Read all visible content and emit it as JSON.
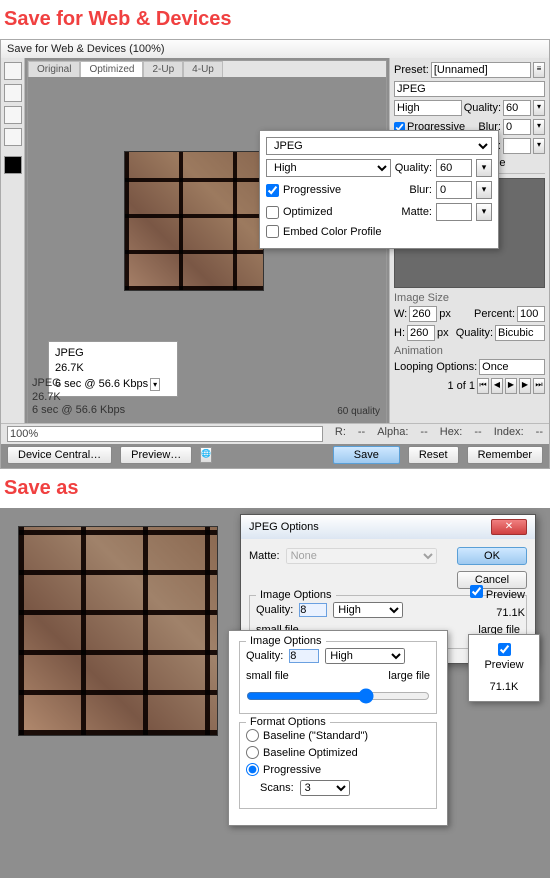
{
  "section1_title": "Save for Web & Devices",
  "sfwd": {
    "window_title": "Save for Web & Devices (100%)",
    "tabs": [
      "Original",
      "Optimized",
      "2-Up",
      "4-Up"
    ],
    "active_tab": 1,
    "preset_label": "Preset:",
    "preset_value": "[Unnamed]",
    "format": "JPEG",
    "quality_mode": "High",
    "quality_label": "Quality:",
    "quality_value": "60",
    "progressive_label": "Progressive",
    "progressive_checked": true,
    "blur_label": "Blur:",
    "blur_value": "0",
    "optimized_label": "Optimized",
    "optimized_checked": false,
    "matte_label": "Matte:",
    "embed_label": "Embed Color Profile",
    "embed_checked": false,
    "info": {
      "format": "JPEG",
      "size": "26.7K",
      "time": "6 sec @ 56.6 Kbps"
    },
    "status_left_format": "JPEG",
    "status_left_size": "26.7K",
    "status_left_time": "6 sec @ 56.6 Kbps",
    "status_right": "60 quality",
    "image_size_hdr": "Image Size",
    "w_label": "W:",
    "w_value": "260",
    "w_unit": "px",
    "h_label": "H:",
    "h_value": "260",
    "h_unit": "px",
    "percent_label": "Percent:",
    "percent_value": "100",
    "resample_label": "Quality:",
    "resample_value": "Bicubic",
    "animation_hdr": "Animation",
    "looping_label": "Looping Options:",
    "looping_value": "Once",
    "frame_text": "1 of 1",
    "zoom": "100%",
    "device_central": "Device Central…",
    "preview": "Preview…",
    "status_items": {
      "r": "R:",
      "a": "Alpha:",
      "hx": "Hex:",
      "idx": "Index:"
    },
    "save": "Save",
    "reset": "Reset",
    "remember": "Remember"
  },
  "callout1": {
    "format": "JPEG",
    "mode": "High",
    "quality_label": "Quality:",
    "quality_value": "60",
    "progressive": "Progressive",
    "blur_label": "Blur:",
    "blur_value": "0",
    "optimized": "Optimized",
    "matte_label": "Matte:",
    "embed": "Embed Color Profile"
  },
  "section2_title": "Save as",
  "jpeg_dialog": {
    "title": "JPEG Options",
    "matte_label": "Matte:",
    "matte_value": "None",
    "ok": "OK",
    "cancel": "Cancel",
    "preview_chk": "Preview",
    "preview_size": "71.1K",
    "img_opts": "Image Options",
    "quality_label": "Quality:",
    "quality_value": "8",
    "quality_mode": "High",
    "small": "small file",
    "large": "large file",
    "format_opts": "Format Options",
    "baseline_std": "Baseline (\"Standard\")",
    "baseline_opt": "Baseline Optimized",
    "progressive": "Progressive",
    "scans_label": "Scans:",
    "scans_value": "3"
  },
  "callout2": {
    "legend": "Image Options",
    "quality_label": "Quality:",
    "quality_value": "8",
    "quality_mode": "High",
    "small": "small file",
    "large": "large file"
  },
  "callout3": {
    "preview": "Preview",
    "size": "71.1K"
  }
}
